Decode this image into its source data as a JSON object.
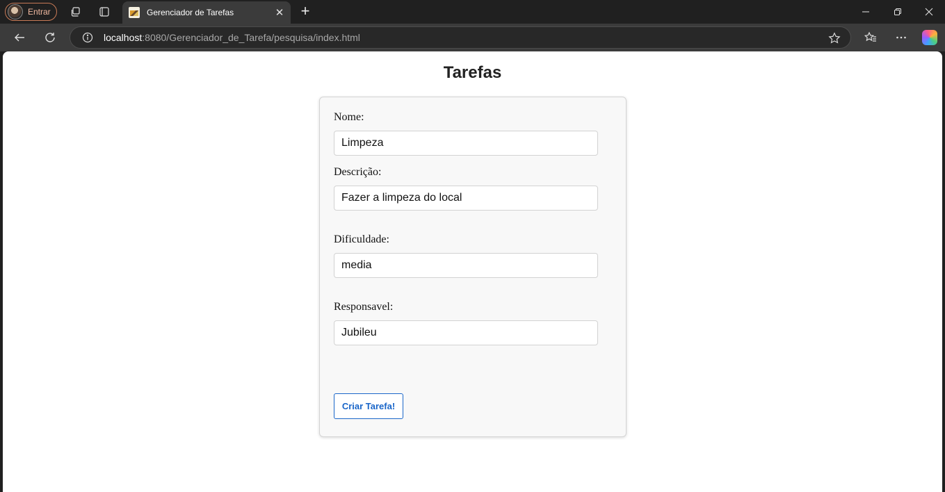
{
  "browser": {
    "profile_label": "Entrar",
    "tab_title": "Gerenciador de Tarefas",
    "tab_close": "✕",
    "new_tab": "+",
    "url_host": "localhost",
    "url_rest": ":8080/Gerenciador_de_Tarefa/pesquisa/index.html"
  },
  "page": {
    "title": "Tarefas"
  },
  "form": {
    "nome_label": "Nome:",
    "nome_value": "Limpeza",
    "descricao_label": "Descrição:",
    "descricao_value": "Fazer a limpeza do local",
    "dificuldade_label": "Dificuldade:",
    "dificuldade_value": "media",
    "responsavel_label": "Responsavel:",
    "responsavel_value": "Jubileu",
    "submit_label": "Criar Tarefa!"
  },
  "colors": {
    "accent": "#1a66c9",
    "chrome_bg": "#202020",
    "toolbar_bg": "#3b3b3b",
    "card_bg": "#f8f8f8"
  }
}
